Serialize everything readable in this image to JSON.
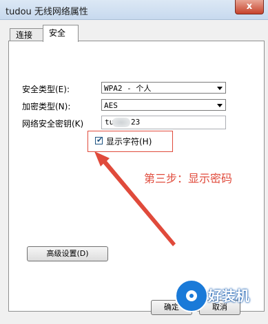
{
  "window": {
    "title": "tudou 无线网络属性",
    "close_label": "x"
  },
  "tabs": [
    {
      "label": "连接"
    },
    {
      "label": "安全"
    }
  ],
  "security": {
    "security_type_label": "安全类型(E):",
    "security_type_value": "WPA2 - 个人",
    "encryption_type_label": "加密类型(N):",
    "encryption_type_value": "AES",
    "key_label": "网络安全密钥(K)",
    "key_value_start": "tu",
    "key_value_end": "23",
    "show_chars_label": "显示字符(H)",
    "show_chars_checked": "✔"
  },
  "annotation": {
    "text": "第三步：显示密码",
    "color": "#e04a3b"
  },
  "buttons": {
    "advanced_label": "高级设置(D)",
    "ok_label": "确定",
    "cancel_label": "取消"
  },
  "watermark": {
    "text": "好装机"
  }
}
